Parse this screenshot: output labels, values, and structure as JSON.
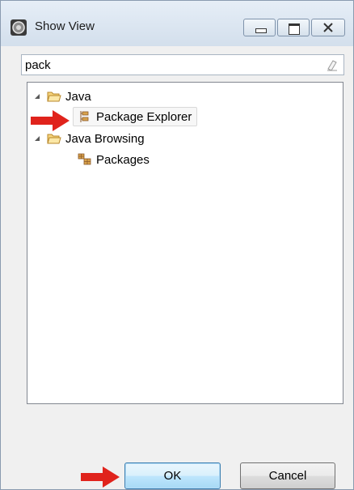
{
  "window": {
    "title": "Show View",
    "icon": "eclipse-view-icon"
  },
  "filter": {
    "value": "pack",
    "clear_icon": "eraser-icon"
  },
  "tree": {
    "items": [
      {
        "label": "Java",
        "icon": "folder-icon",
        "expanded": true,
        "level": 0
      },
      {
        "label": "Package Explorer",
        "icon": "package-explorer-icon",
        "level": 1,
        "selected": true
      },
      {
        "label": "Java Browsing",
        "icon": "folder-icon",
        "expanded": true,
        "level": 0
      },
      {
        "label": "Packages",
        "icon": "packages-icon",
        "level": 1
      }
    ]
  },
  "buttons": {
    "ok": "OK",
    "cancel": "Cancel"
  },
  "colors": {
    "arrow": "#e0231c",
    "ok_border": "#3c7fb1",
    "folder": "#e8b84a"
  }
}
